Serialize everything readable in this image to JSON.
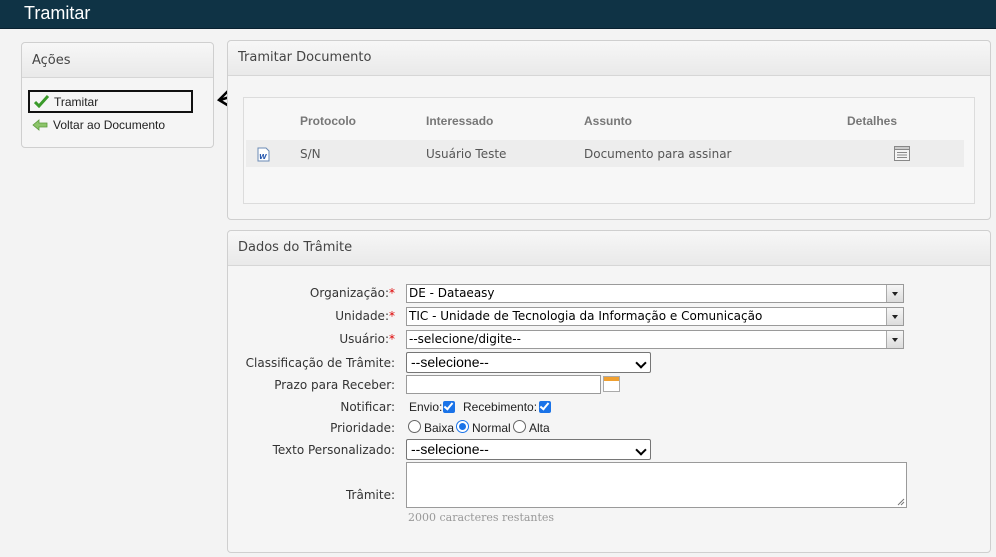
{
  "header": {
    "title": "Tramitar"
  },
  "acoes": {
    "title": "Ações",
    "items": [
      {
        "label": "Tramitar",
        "icon": "check-icon"
      },
      {
        "label": "Voltar ao Documento",
        "icon": "back-arrow-icon"
      }
    ]
  },
  "tramitar_documento": {
    "title": "Tramitar Documento",
    "columns": [
      "Protocolo",
      "Interessado",
      "Assunto",
      "Detalhes"
    ],
    "rows": [
      {
        "icon": "word-document-icon",
        "protocolo": "S/N",
        "interessado": "Usuário Teste",
        "assunto": "Documento para assinar",
        "detalhes_icon": "details-icon"
      }
    ]
  },
  "dados_tramite": {
    "title": "Dados do Trâmite",
    "organizacao": {
      "label": "Organização:",
      "required": "*",
      "value": "DE - Dataeasy"
    },
    "unidade": {
      "label": "Unidade:",
      "required": "*",
      "value": "TIC - Unidade de Tecnologia da Informação e Comunicação"
    },
    "usuario": {
      "label": "Usuário:",
      "required": "*",
      "value": "--selecione/digite--"
    },
    "classificacao": {
      "label": "Classificação de Trâmite:",
      "value": "--selecione--"
    },
    "prazo": {
      "label": "Prazo para Receber:",
      "value": ""
    },
    "notificar": {
      "label": "Notificar:",
      "envio": "Envio:",
      "recebimento": "Recebimento:",
      "envio_checked": true,
      "recebimento_checked": true
    },
    "prioridade": {
      "label": "Prioridade:",
      "options": [
        "Baixa",
        "Normal",
        "Alta"
      ],
      "selected": "Normal"
    },
    "texto_personalizado": {
      "label": "Texto Personalizado:",
      "value": "--selecione--"
    },
    "tramite": {
      "label": "Trâmite:",
      "value": "",
      "counter": "2000 caracteres restantes"
    }
  },
  "colors": {
    "topbar": "#0f3345",
    "accent": "#1a73e8",
    "required": "#dd0000"
  }
}
